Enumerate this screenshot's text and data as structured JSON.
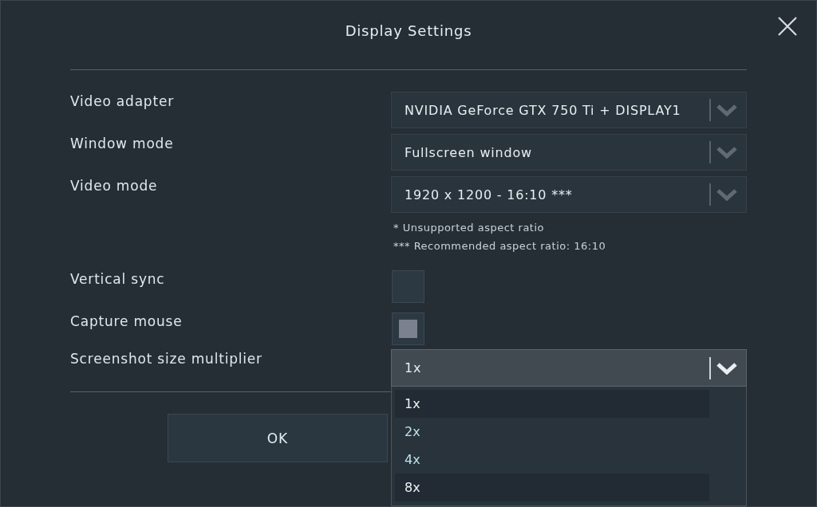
{
  "window": {
    "title": "Display Settings"
  },
  "settings": [
    {
      "label": "Video adapter",
      "kind": "dropdown",
      "value": "NVIDIA GeForce GTX 750 Ti + DISPLAY1",
      "expanded": false
    },
    {
      "label": "Window mode",
      "kind": "dropdown",
      "value": "Fullscreen window",
      "expanded": false
    },
    {
      "label": "Video mode",
      "kind": "dropdown",
      "value": "1920 x 1200 - 16:10 ***",
      "expanded": false,
      "notes": [
        "* Unsupported aspect ratio",
        "*** Recommended aspect ratio: 16:10"
      ]
    },
    {
      "label": "Vertical sync",
      "kind": "checkbox",
      "checked": false
    },
    {
      "label": "Capture mouse",
      "kind": "checkbox",
      "checked": true
    },
    {
      "label": "Screenshot size multiplier",
      "kind": "dropdown",
      "value": "1x",
      "expanded": true,
      "options": [
        {
          "label": "1x",
          "highlighted": true
        },
        {
          "label": "2x",
          "highlighted": false
        },
        {
          "label": "4x",
          "highlighted": false
        },
        {
          "label": "8x",
          "highlighted": true
        }
      ]
    }
  ],
  "buttons": [
    "OK"
  ]
}
